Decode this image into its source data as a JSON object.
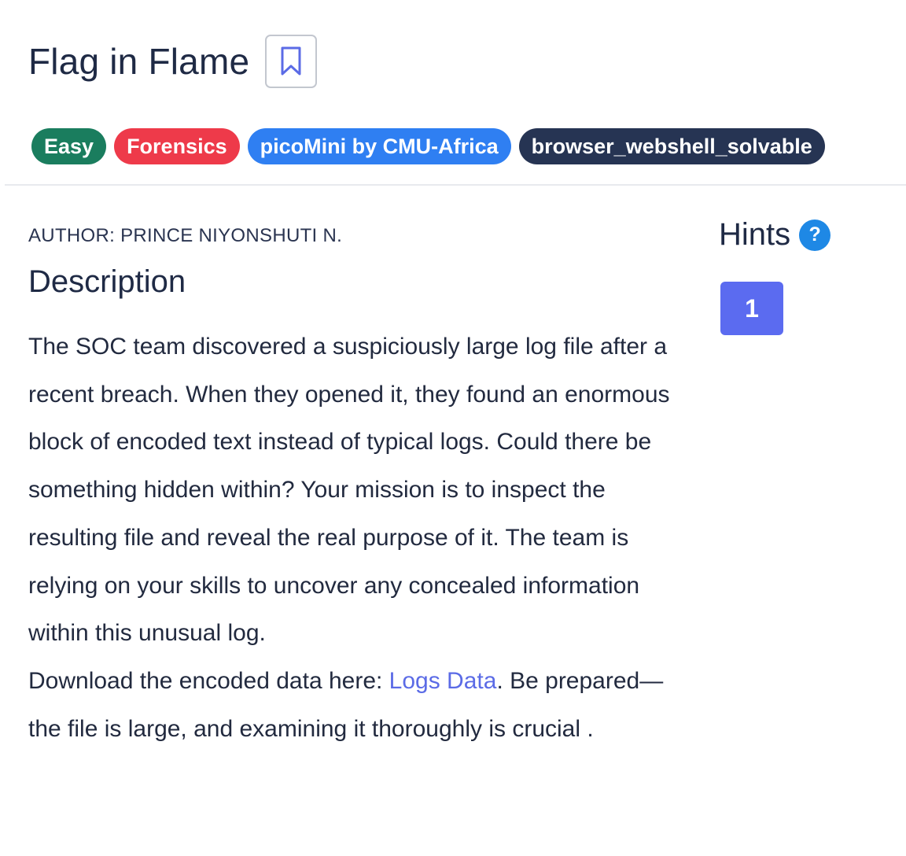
{
  "challenge": {
    "title": "Flag in Flame",
    "bookmark_icon": "bookmark-icon"
  },
  "tags": [
    {
      "label": "Easy",
      "color": "#1a7d5e"
    },
    {
      "label": "Forensics",
      "color": "#ee3a4a"
    },
    {
      "label": "picoMini by CMU-Africa",
      "color": "#2f7ff2"
    },
    {
      "label": "browser_webshell_solvable",
      "color": "#263453"
    }
  ],
  "author": "AUTHOR: PRINCE NIYONSHUTI N.",
  "description": {
    "heading": "Description",
    "paragraph": "The SOC team discovered a suspiciously large log file after a recent breach. When they opened it, they found an enormous block of encoded text instead of typical logs. Could there be something hidden within? Your mission is to inspect the resulting file and reveal the real purpose of it. The team is relying on your skills to uncover any concealed information within this unusual log.",
    "download_prefix": "Download the encoded data here: ",
    "download_link": "Logs Data",
    "download_suffix": ". Be prepared—the file is large, and examining it thoroughly is crucial ."
  },
  "hints": {
    "title": "Hints",
    "help_icon": "question-circle-icon",
    "help_glyph": "?",
    "buttons": [
      "1"
    ]
  }
}
